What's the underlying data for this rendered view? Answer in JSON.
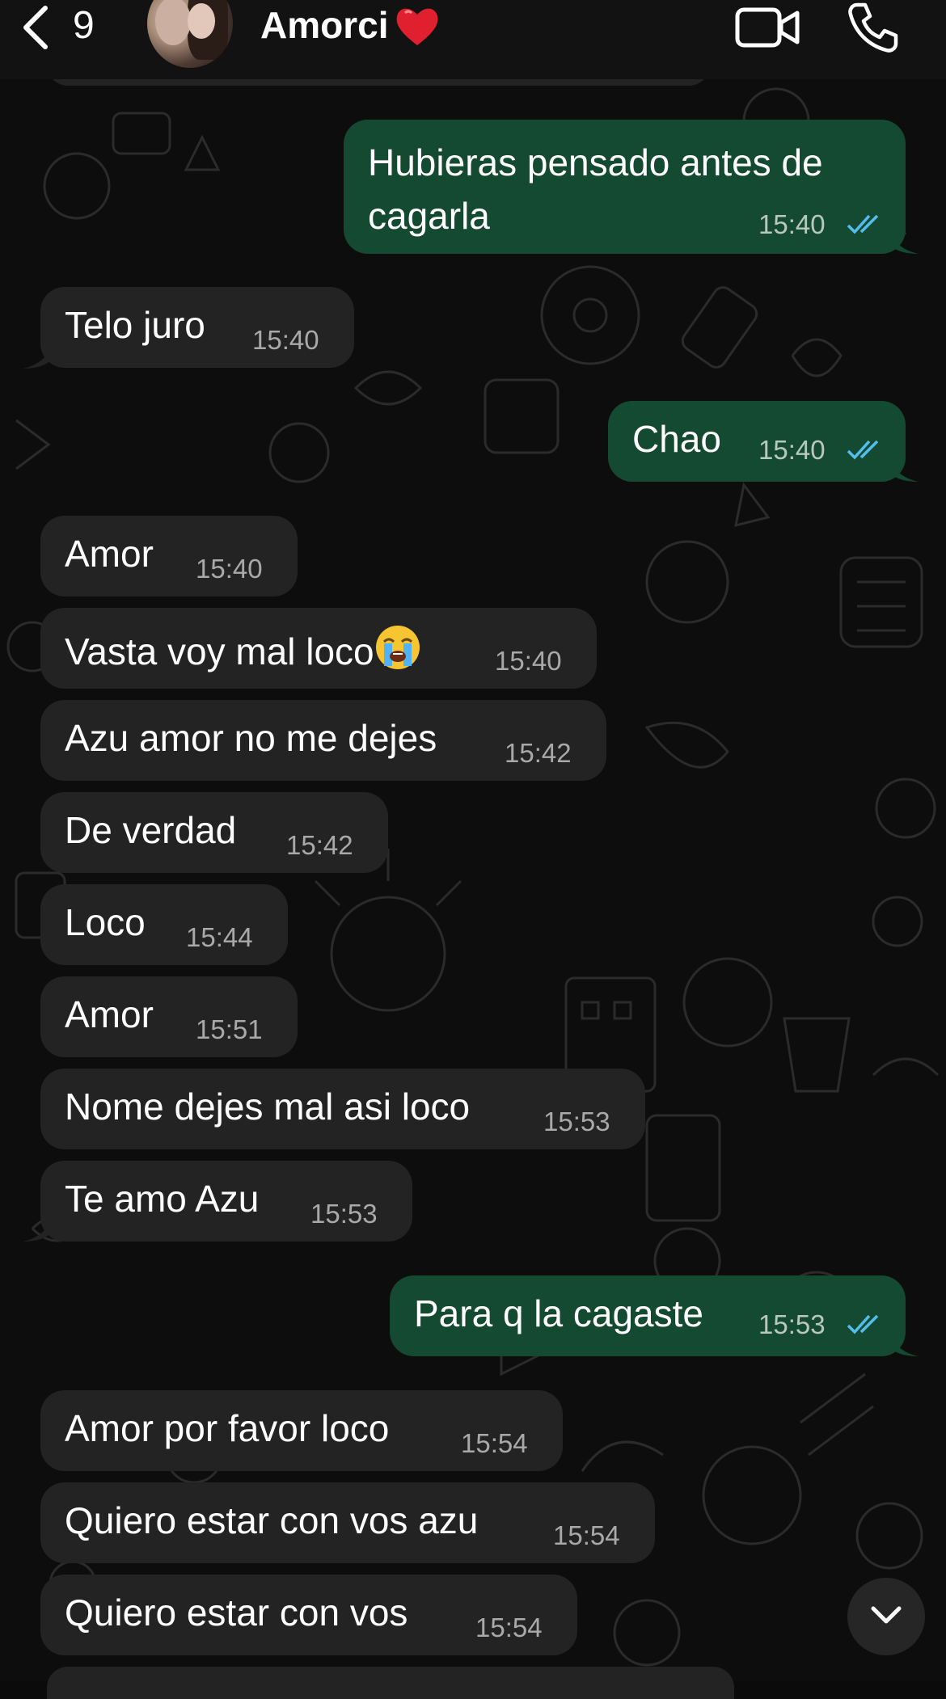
{
  "header": {
    "back_count": "9",
    "contact_name": "Amorci",
    "icons": [
      "chevron-left-icon",
      "heart-icon",
      "video-call-icon",
      "phone-icon"
    ],
    "colors": {
      "header_bg": "#121212",
      "heart": "#e0202e"
    }
  },
  "messages": [
    {
      "direction": "out",
      "lines": [
        "Hubieras pensado antes de",
        "cagarla"
      ],
      "time": "15:40",
      "status": "read"
    },
    {
      "direction": "in",
      "text": "Telo juro",
      "time": "15:40"
    },
    {
      "direction": "out",
      "text": "Chao",
      "time": "15:40",
      "status": "read"
    },
    {
      "direction": "in",
      "text": "Amor",
      "time": "15:40"
    },
    {
      "direction": "in",
      "text": "Vasta voy mal loco",
      "emoji": "loudly-crying-face",
      "time": "15:40"
    },
    {
      "direction": "in",
      "text": "Azu amor no me dejes",
      "time": "15:42"
    },
    {
      "direction": "in",
      "text": "De verdad",
      "time": "15:42"
    },
    {
      "direction": "in",
      "text": "Loco",
      "time": "15:44"
    },
    {
      "direction": "in",
      "text": "Amor",
      "time": "15:51"
    },
    {
      "direction": "in",
      "text": "Nome dejes mal asi loco",
      "time": "15:53"
    },
    {
      "direction": "in",
      "text": "Te amo Azu",
      "time": "15:53"
    },
    {
      "direction": "out",
      "text": "Para q la cagaste",
      "time": "15:53",
      "status": "read"
    },
    {
      "direction": "in",
      "text": "Amor por favor loco",
      "time": "15:54"
    },
    {
      "direction": "in",
      "text": "Quiero estar con vos azu",
      "time": "15:54"
    },
    {
      "direction": "in",
      "text": "Quiero estar con vos",
      "time": "15:54"
    }
  ],
  "scroll_button_icon": "chevron-down-icon",
  "colors": {
    "incoming_bubble": "#232323",
    "outgoing_bubble": "#154a32",
    "read_ticks": "#53bdeb",
    "background": "#0b0b0b"
  }
}
